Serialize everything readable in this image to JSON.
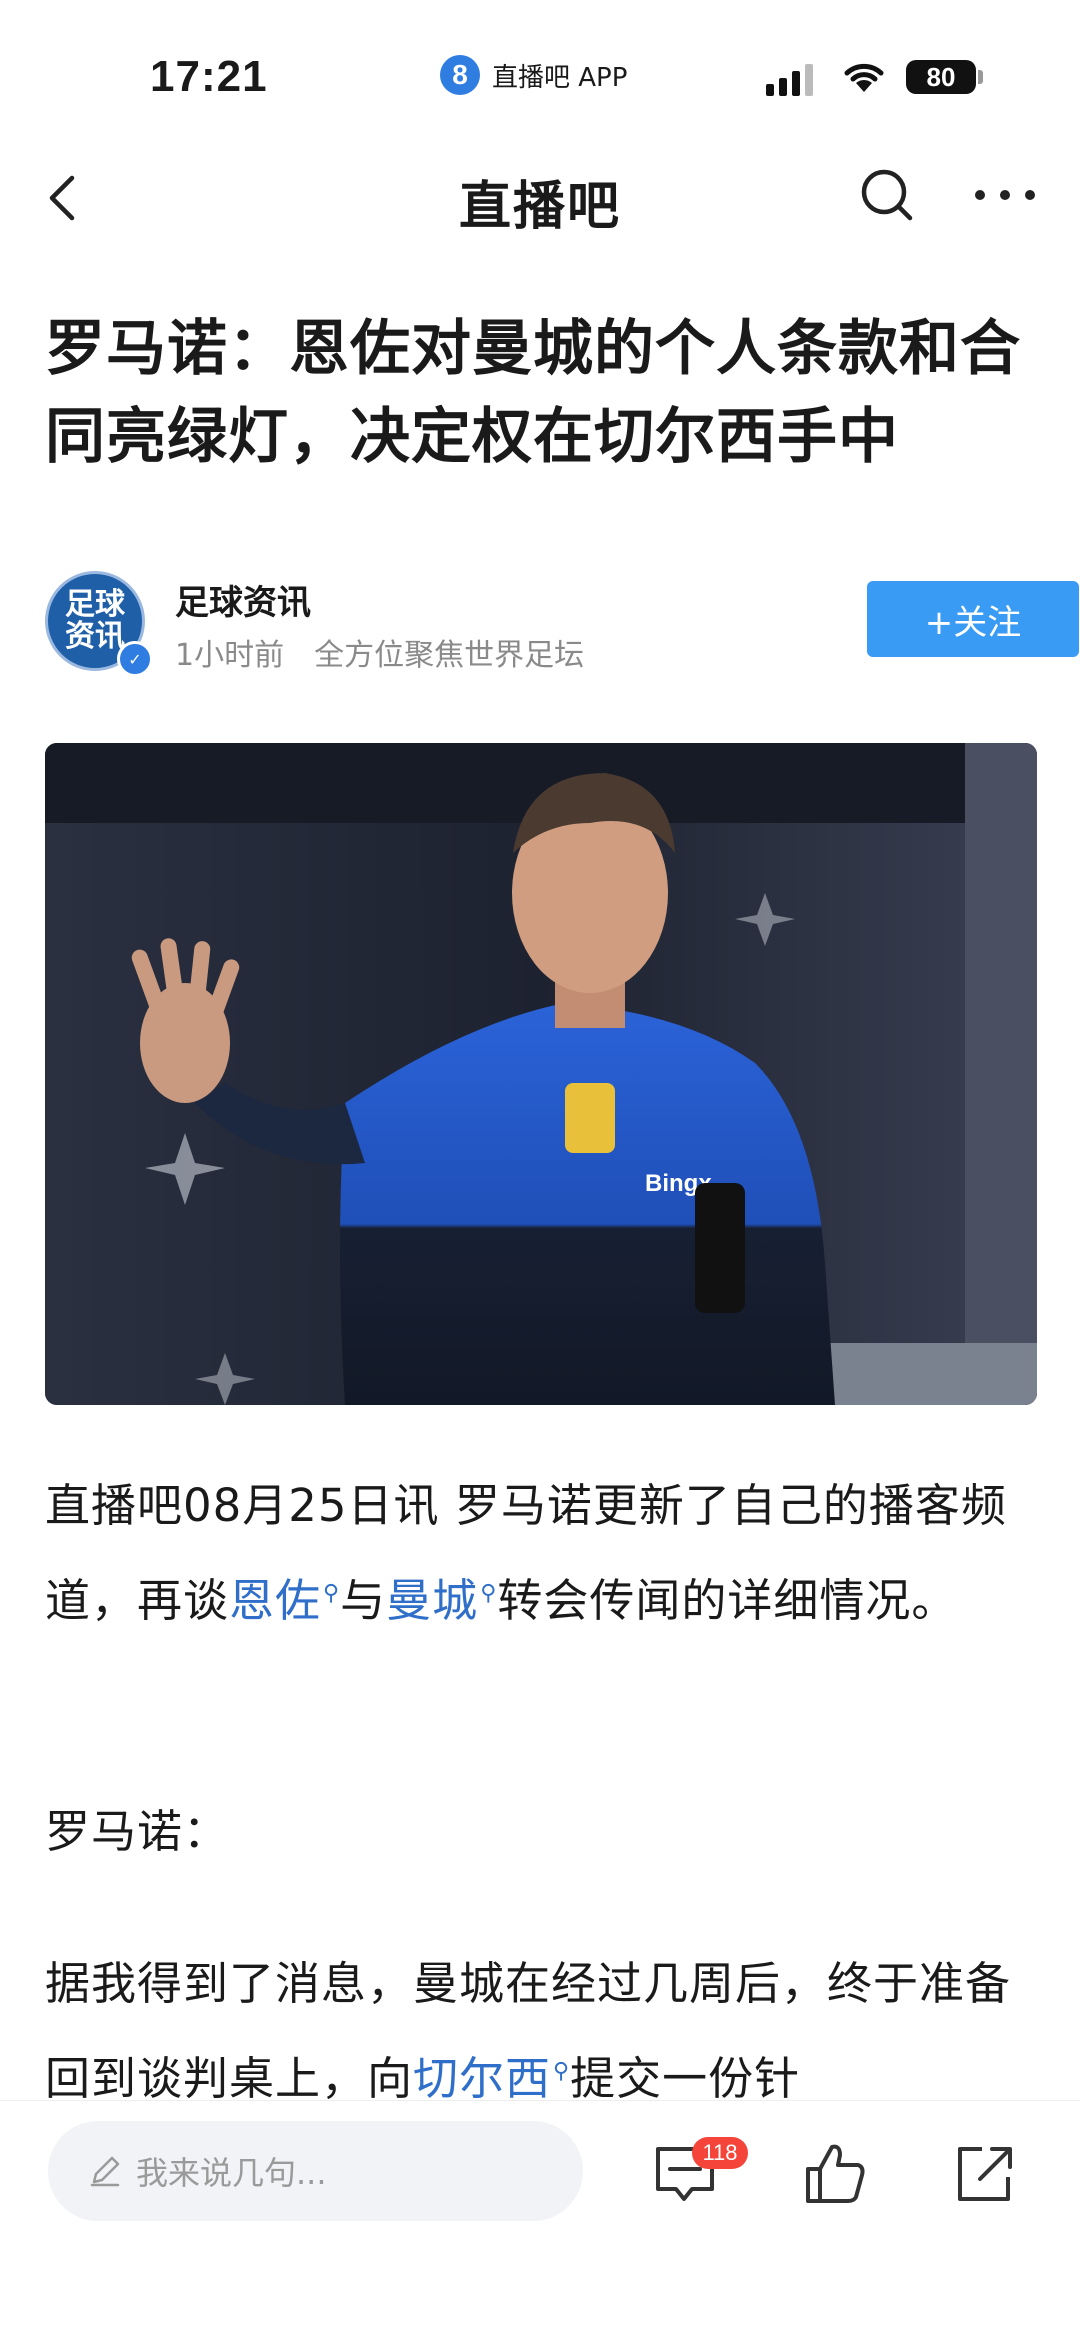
{
  "status_bar": {
    "time": "17:21",
    "app_badge": "8",
    "app_name": "直播吧 APP",
    "battery": "80"
  },
  "nav": {
    "brand": "直播吧"
  },
  "article": {
    "title": "罗马诺：恩佐对曼城的个人条款和合同亮绿灯，决定权在切尔西手中",
    "author": {
      "name": "足球资讯",
      "avatar_text": "足球资讯",
      "time": "1小时前",
      "bio": "全方位聚焦世界足坛",
      "follow_label": "+关注"
    },
    "p1": {
      "before": "直播吧08月25日讯  罗马诺更新了自己的播客频道，再谈",
      "link1": "恩佐",
      "mid": "与",
      "link2": "曼城",
      "after": "转会传闻的详细情况。"
    },
    "p2": "罗马诺：",
    "p3": {
      "before": "据我得到了消息，曼城在经过几周后，终于准备回到谈判桌上，向",
      "link": "切尔西",
      "after": "提交一份针"
    }
  },
  "bottom_bar": {
    "comment_placeholder": "我来说几句...",
    "comment_count": "118"
  },
  "colors": {
    "accent": "#3a9bf5",
    "link": "#2f6fca",
    "badge": "#f5453b"
  },
  "icons": [
    "back-icon",
    "search-icon",
    "more-icon",
    "pen-icon",
    "comment-icon",
    "like-icon",
    "share-icon",
    "search-mini-icon"
  ]
}
